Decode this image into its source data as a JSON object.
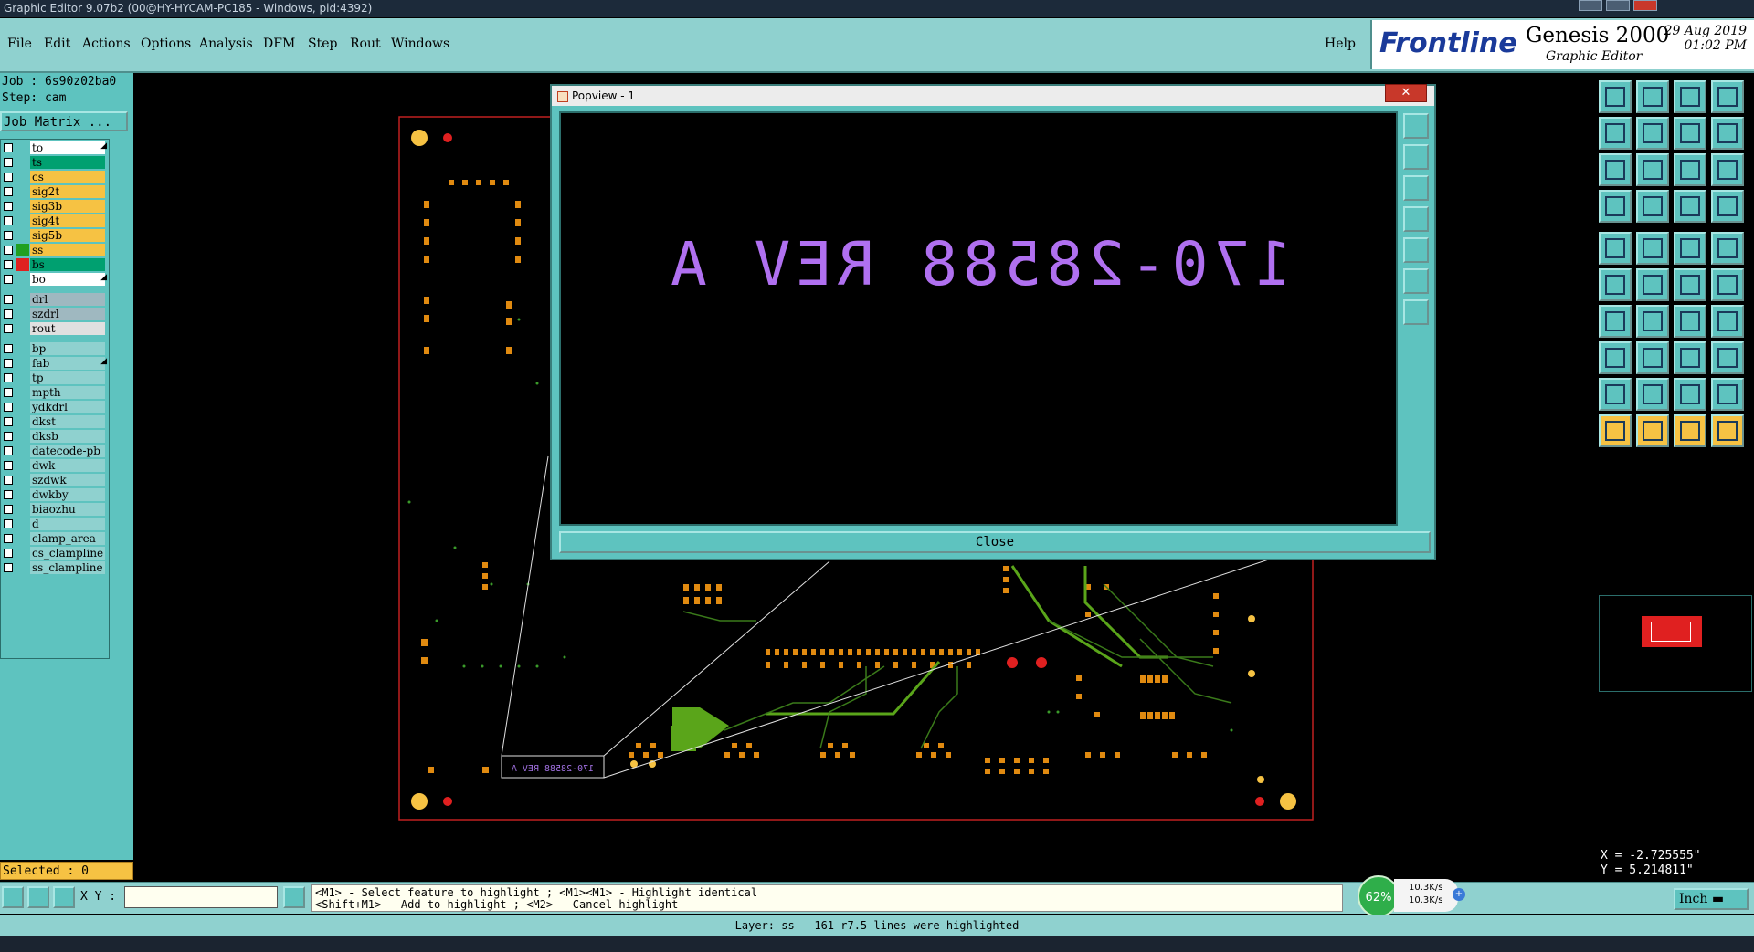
{
  "window": {
    "title": "Graphic Editor 9.07b2 (00@HY-HYCAM-PC185 - Windows, pid:4392)"
  },
  "menu": {
    "items": [
      "File",
      "Edit",
      "Actions",
      "Options",
      "Analysis",
      "DFM",
      "Step",
      "Rout",
      "Windows"
    ],
    "help": "Help"
  },
  "branding": {
    "logo": "Frontline",
    "product": "Genesis 2000",
    "subtitle": "Graphic Editor",
    "date": "29 Aug 2019",
    "time": "01:02 PM"
  },
  "job": {
    "job_label": "Job : 6s90z02ba0",
    "step_label": "Step: cam",
    "matrix_button": "Job Matrix ..."
  },
  "layers": [
    {
      "name": "to",
      "color": "#ffffff",
      "bg": "#ffffff",
      "arrow": true
    },
    {
      "name": "ts",
      "color": "#00a070",
      "bg": "#00a070",
      "arrow": false
    },
    {
      "name": "cs",
      "color": "#f6c243",
      "bg": "#f6c243",
      "arrow": false
    },
    {
      "name": "sig2t",
      "color": "#f6c243",
      "bg": "#f6c243",
      "arrow": false
    },
    {
      "name": "sig3b",
      "color": "#f6c243",
      "bg": "#f6c243",
      "arrow": false
    },
    {
      "name": "sig4t",
      "color": "#f6c243",
      "bg": "#f6c243",
      "arrow": false
    },
    {
      "name": "sig5b",
      "color": "#f6c243",
      "bg": "#f6c243",
      "arrow": false
    },
    {
      "name": "ss",
      "color": "#20a020",
      "bg": "#f6c243",
      "arrow": false
    },
    {
      "name": "bs",
      "color": "#e02020",
      "bg": "#00a070",
      "arrow": false
    },
    {
      "name": "bo",
      "color": "#ffffff",
      "bg": "#ffffff",
      "arrow": true
    },
    {
      "name": "drl",
      "color": "#9fb8c0",
      "bg": "#9fb8c0",
      "arrow": false
    },
    {
      "name": "szdrl",
      "color": "#9fb8c0",
      "bg": "#9fb8c0",
      "arrow": false
    },
    {
      "name": "rout",
      "color": "#e0e0e0",
      "bg": "#e0e0e0",
      "arrow": false
    },
    {
      "name": "bp",
      "color": "#8fd1cf",
      "bg": "#8fd1cf",
      "arrow": false
    },
    {
      "name": "fab",
      "color": "#8fd1cf",
      "bg": "#8fd1cf",
      "arrow": true
    },
    {
      "name": "tp",
      "color": "#8fd1cf",
      "bg": "#8fd1cf",
      "arrow": false
    },
    {
      "name": "mpth",
      "color": "#8fd1cf",
      "bg": "#8fd1cf",
      "arrow": false
    },
    {
      "name": "ydkdrl",
      "color": "#8fd1cf",
      "bg": "#8fd1cf",
      "arrow": false
    },
    {
      "name": "dkst",
      "color": "#8fd1cf",
      "bg": "#8fd1cf",
      "arrow": false
    },
    {
      "name": "dksb",
      "color": "#8fd1cf",
      "bg": "#8fd1cf",
      "arrow": false
    },
    {
      "name": "datecode-pb",
      "color": "#8fd1cf",
      "bg": "#8fd1cf",
      "arrow": false
    },
    {
      "name": "dwk",
      "color": "#8fd1cf",
      "bg": "#8fd1cf",
      "arrow": false
    },
    {
      "name": "szdwk",
      "color": "#8fd1cf",
      "bg": "#8fd1cf",
      "arrow": false
    },
    {
      "name": "dwkby",
      "color": "#8fd1cf",
      "bg": "#8fd1cf",
      "arrow": false
    },
    {
      "name": "biaozhu",
      "color": "#8fd1cf",
      "bg": "#8fd1cf",
      "arrow": false
    },
    {
      "name": "d",
      "color": "#8fd1cf",
      "bg": "#8fd1cf",
      "arrow": false
    },
    {
      "name": "clamp_area",
      "color": "#8fd1cf",
      "bg": "#8fd1cf",
      "arrow": false
    },
    {
      "name": "cs_clampline",
      "color": "#8fd1cf",
      "bg": "#8fd1cf",
      "arrow": false
    },
    {
      "name": "ss_clampline",
      "color": "#8fd1cf",
      "bg": "#8fd1cf",
      "arrow": false
    }
  ],
  "selected": "Selected : 0",
  "popview": {
    "title": "Popview - 1",
    "close_x": "✕",
    "mirrored_text": "170-28588 REV A",
    "close_button": "Close"
  },
  "board": {
    "label_text": "170-28588 REV A"
  },
  "coords": {
    "x": "X = -2.725555\"",
    "y": "Y = 5.214811\""
  },
  "bottom": {
    "xy_label": "X Y :",
    "xy_value": "",
    "hint_line1": "<M1> - Select feature to highlight ; <M1><M1> - Highlight identical",
    "hint_line2": "<Shift+M1> - Add to highlight ; <M2> - Cancel highlight",
    "unit": "Inch",
    "net_percent": "62%",
    "net_up": "10.3K/s",
    "net_down": "10.3K/s"
  },
  "status": "Layer: ss - 161 r7.5 lines were highlighted"
}
